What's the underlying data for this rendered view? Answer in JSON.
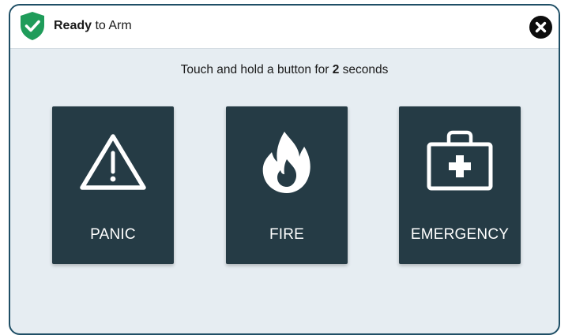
{
  "header": {
    "status_bold": "Ready",
    "status_rest": " to Arm",
    "status_icon": "shield-check-icon",
    "close_icon": "close-icon"
  },
  "instruction": {
    "prefix": "Touch and hold a button for ",
    "seconds": "2",
    "suffix": " seconds"
  },
  "tiles": [
    {
      "label": "PANIC",
      "icon": "warning-triangle-icon"
    },
    {
      "label": "FIRE",
      "icon": "flame-icon"
    },
    {
      "label": "EMERGENCY",
      "icon": "first-aid-kit-icon"
    }
  ],
  "colors": {
    "shield": "#1f9c5a",
    "tile_background": "#253b45",
    "panel_background": "#e6edf2",
    "panel_border": "#1f4f66"
  }
}
